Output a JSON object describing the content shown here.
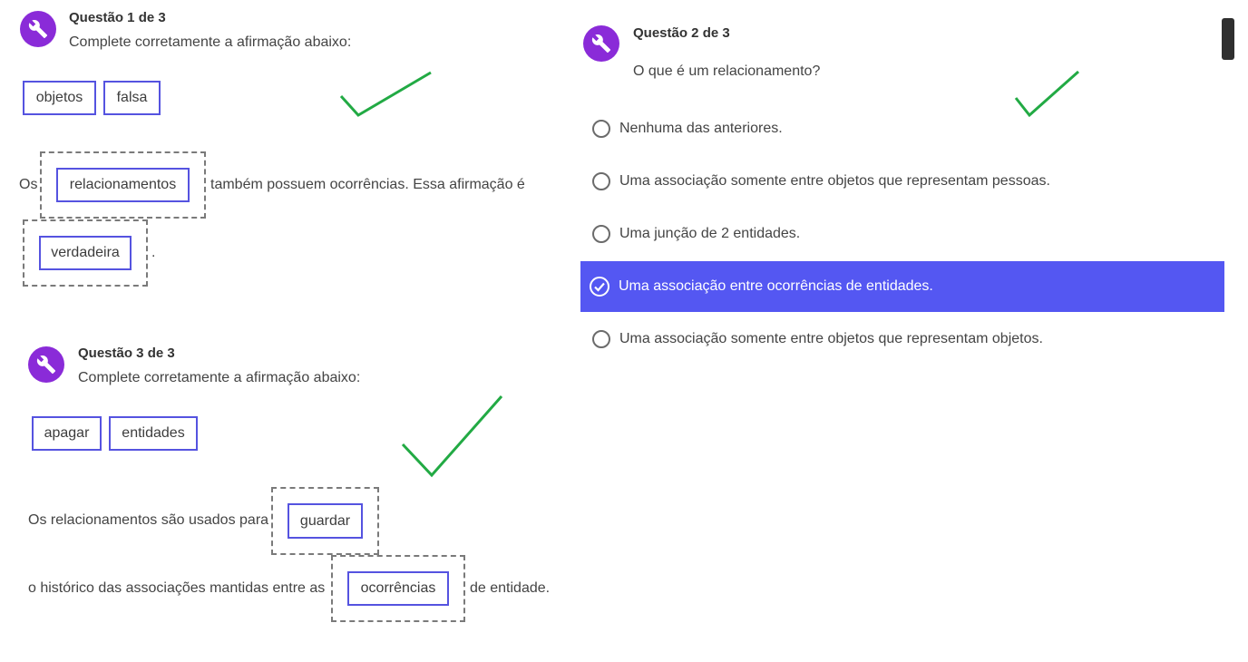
{
  "q1": {
    "title": "Questão 1 de 3",
    "instruction": "Complete corretamente a afirmação abaixo:",
    "bank": [
      "objetos",
      "falsa"
    ],
    "sentence_before": "Os",
    "blank1": "relacionamentos",
    "sentence_middle": "também possuem ocorrências. Essa afirmação é",
    "blank2": "verdadeira",
    "sentence_end": "."
  },
  "q2": {
    "title": "Questão 2 de 3",
    "question": "O que é um relacionamento?",
    "options": [
      "Nenhuma das anteriores.",
      "Uma associação somente entre objetos que representam pessoas.",
      "Uma junção de 2 entidades.",
      "Uma associação entre ocorrências de entidades.",
      "Uma associação somente entre objetos que representam objetos."
    ],
    "selected_index": 3
  },
  "q3": {
    "title": "Questão 3 de 3",
    "instruction": "Complete corretamente a afirmação abaixo:",
    "bank": [
      "apagar",
      "entidades"
    ],
    "sentence_part1": "Os relacionamentos são usados para",
    "blank1": "guardar",
    "sentence_part2": "o histórico das associações mantidas entre as",
    "blank2": "ocorrências",
    "sentence_end": "de entidade."
  },
  "icons": {
    "badge": "wrench-icon",
    "check": "checkmark-icon",
    "selected_radio": "check-circle-icon"
  },
  "colors": {
    "badge": "#8a2bd8",
    "chip_border": "#5553e0",
    "selected_option": "#5457f2",
    "checkmark": "#22aa44"
  }
}
